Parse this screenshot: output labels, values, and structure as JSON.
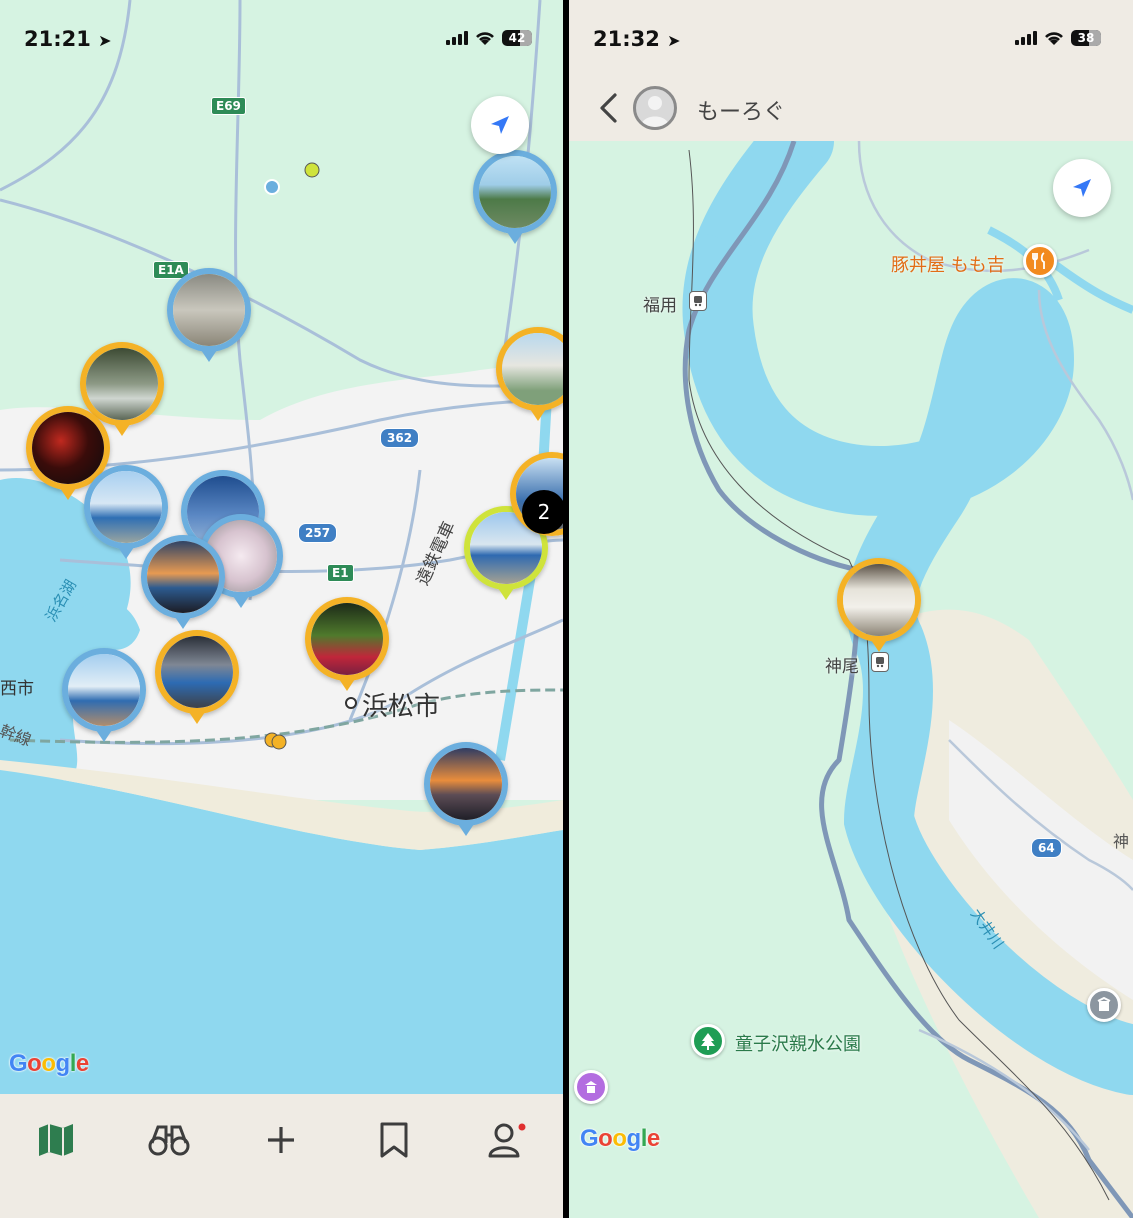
{
  "left_screen": {
    "status_bar": {
      "time": "21:21",
      "battery": "42"
    },
    "map": {
      "labels": {
        "city": "浜松市",
        "lake": "浜名湖",
        "railway": "遠鉄電車",
        "west_city": "西市",
        "shinkansen": "幹線"
      },
      "route_shields": [
        "E69",
        "E1A",
        "362",
        "257",
        "E1"
      ],
      "cluster_count": "2",
      "google_logo": "Google"
    },
    "tab_bar": {
      "items": [
        {
          "icon": "map-icon"
        },
        {
          "icon": "binoculars-icon"
        },
        {
          "icon": "plus-icon"
        },
        {
          "icon": "bookmark-icon"
        },
        {
          "icon": "profile-icon"
        }
      ]
    }
  },
  "right_screen": {
    "status_bar": {
      "time": "21:32",
      "battery": "38"
    },
    "nav": {
      "title": "もーろぐ"
    },
    "map": {
      "labels": {
        "restaurant": "豚丼屋 もも吉",
        "station_north": "福用",
        "station_south": "神尾",
        "park": "童子沢親水公園",
        "river": "大井川",
        "edge_label": "神"
      },
      "route_shields": [
        "64"
      ],
      "google_logo": "Google"
    }
  },
  "colors": {
    "map_land": "#d6f3e2",
    "urban": "#f2f2f2",
    "water": "#8fd8ef",
    "pin_blue": "#6baede",
    "pin_orange": "#f4b226",
    "pin_lime": "#cfe33b",
    "accent_blue": "#3478f6",
    "poi_orange": "#f28a1e",
    "poi_green": "#1f9d55",
    "poi_purple": "#b36de0",
    "tab_icon": "#3d3d3d",
    "map_tab_active": "#2e7d4f",
    "bar_bg": "#efebe4"
  }
}
